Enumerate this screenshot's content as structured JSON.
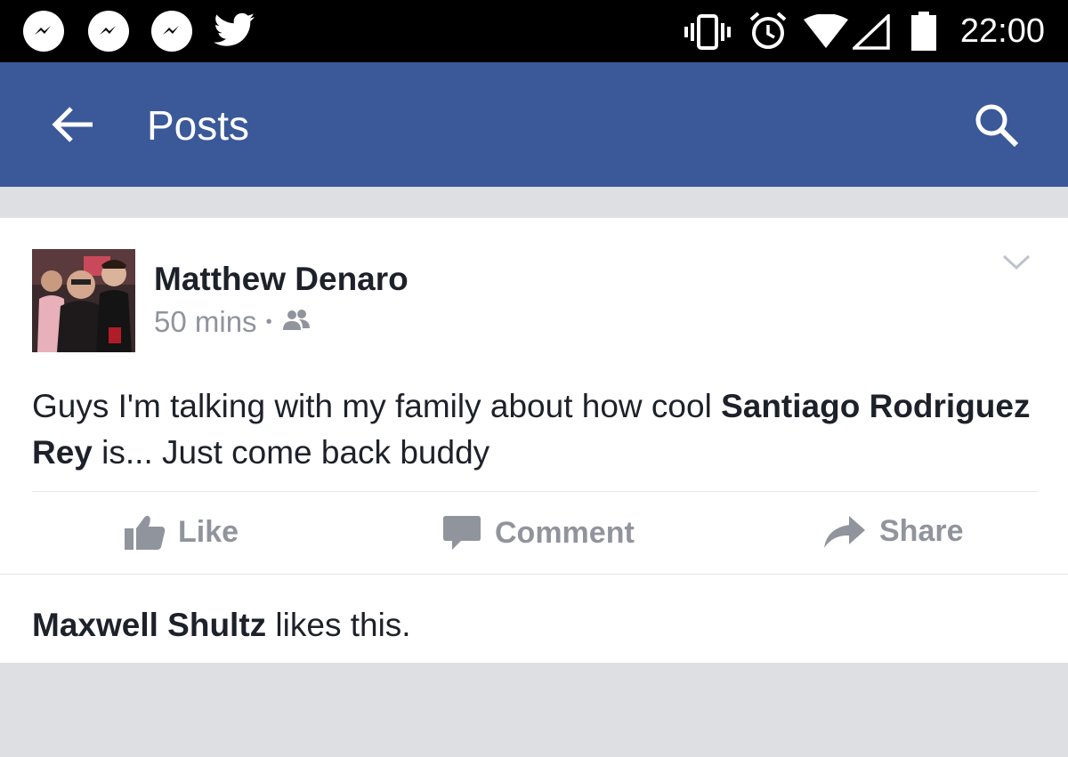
{
  "status_bar": {
    "time": "22:00",
    "left_icons": [
      "messenger-icon",
      "messenger-icon",
      "messenger-icon",
      "twitter-icon"
    ],
    "right_icons": [
      "vibrate-icon",
      "alarm-icon",
      "wifi-icon",
      "signal-icon",
      "battery-icon"
    ]
  },
  "app_bar": {
    "title": "Posts",
    "background": "#3b5998"
  },
  "post": {
    "author": "Matthew Denaro",
    "time": "50 mins",
    "separator": "•",
    "privacy_icon": "friends-icon",
    "text_before": "Guys I'm talking with my family about how cool ",
    "mention": "Santiago Rodriguez Rey",
    "text_after": " is... Just come back buddy",
    "actions": {
      "like": "Like",
      "comment": "Comment",
      "share": "Share"
    },
    "likers": {
      "name": "Maxwell Shultz",
      "suffix": " likes this."
    }
  }
}
